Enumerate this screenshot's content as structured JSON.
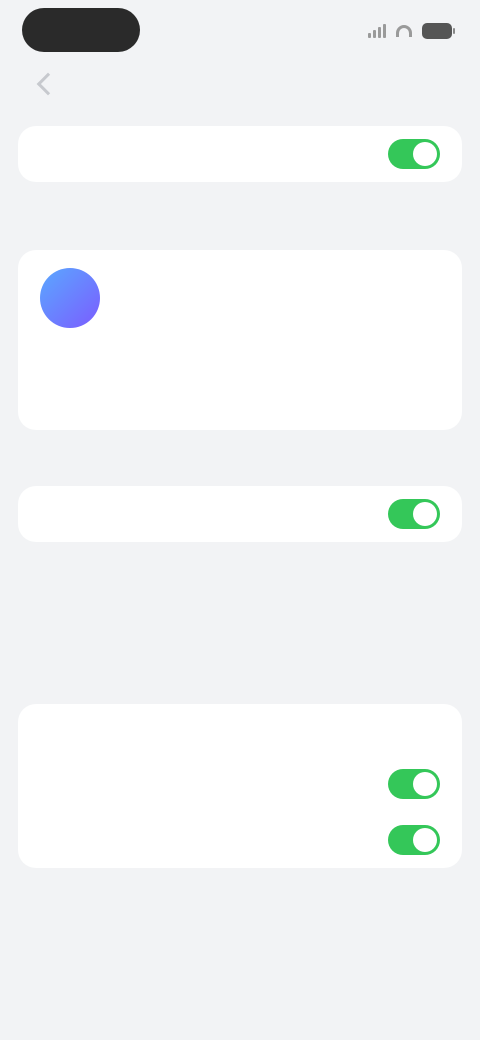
{
  "status_bar": {
    "time": "",
    "icons": [
      "signal-icon",
      "wifi-icon",
      "battery-icon"
    ]
  },
  "nav": {
    "title": "",
    "back_icon": "chevron-left-icon"
  },
  "section1": {
    "toggle_label": "",
    "toggle_on": true,
    "footnote_text": "",
    "footnote_link": ""
  },
  "account_card": {
    "avatar_icon": "avatar-icon",
    "title": "",
    "subtitle": "",
    "action_label": ""
  },
  "section2": {
    "header_text": "",
    "toggle_label": "",
    "toggle_on": true,
    "footnote_1": "",
    "footnote_2": ""
  },
  "section3": {
    "header_text": "",
    "rows": [
      {
        "label": "",
        "on": true
      },
      {
        "label": "",
        "on": true
      }
    ],
    "footnote": ""
  },
  "colors": {
    "background": "#f2f3f5",
    "card": "#ffffff",
    "toggle_on": "#34c759",
    "link": "#3a7bfd",
    "avatar_gradient_start": "#5aa8ff",
    "avatar_gradient_end": "#7b5cff"
  }
}
